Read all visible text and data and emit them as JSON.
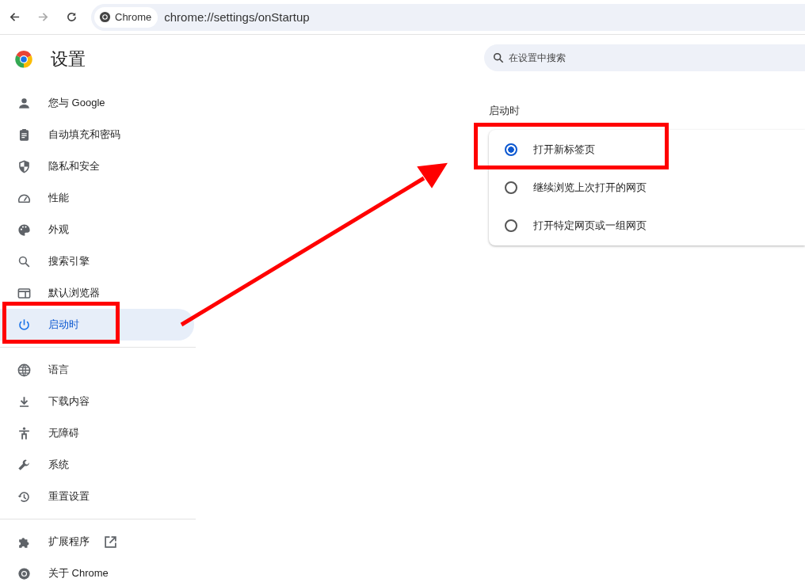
{
  "toolbar": {
    "chip": "Chrome",
    "url": "chrome://settings/onStartup"
  },
  "header": {
    "title": "设置"
  },
  "search": {
    "placeholder": "在设置中搜索"
  },
  "sidebar": {
    "groups": [
      [
        {
          "label": "您与 Google",
          "selected": false
        },
        {
          "label": "自动填充和密码",
          "selected": false
        },
        {
          "label": "隐私和安全",
          "selected": false
        },
        {
          "label": "性能",
          "selected": false
        },
        {
          "label": "外观",
          "selected": false
        },
        {
          "label": "搜索引擎",
          "selected": false
        },
        {
          "label": "默认浏览器",
          "selected": false
        },
        {
          "label": "启动时",
          "selected": true
        }
      ],
      [
        {
          "label": "语言",
          "selected": false
        },
        {
          "label": "下载内容",
          "selected": false
        },
        {
          "label": "无障碍",
          "selected": false
        },
        {
          "label": "系统",
          "selected": false
        },
        {
          "label": "重置设置",
          "selected": false
        }
      ],
      [
        {
          "label": "扩展程序",
          "selected": false
        },
        {
          "label": "关于 Chrome",
          "selected": false
        }
      ]
    ]
  },
  "startup": {
    "heading": "启动时",
    "options": [
      {
        "label": "打开新标签页",
        "selected": true
      },
      {
        "label": "继续浏览上次打开的网页",
        "selected": false
      },
      {
        "label": "打开特定网页或一组网页",
        "selected": false
      }
    ]
  }
}
